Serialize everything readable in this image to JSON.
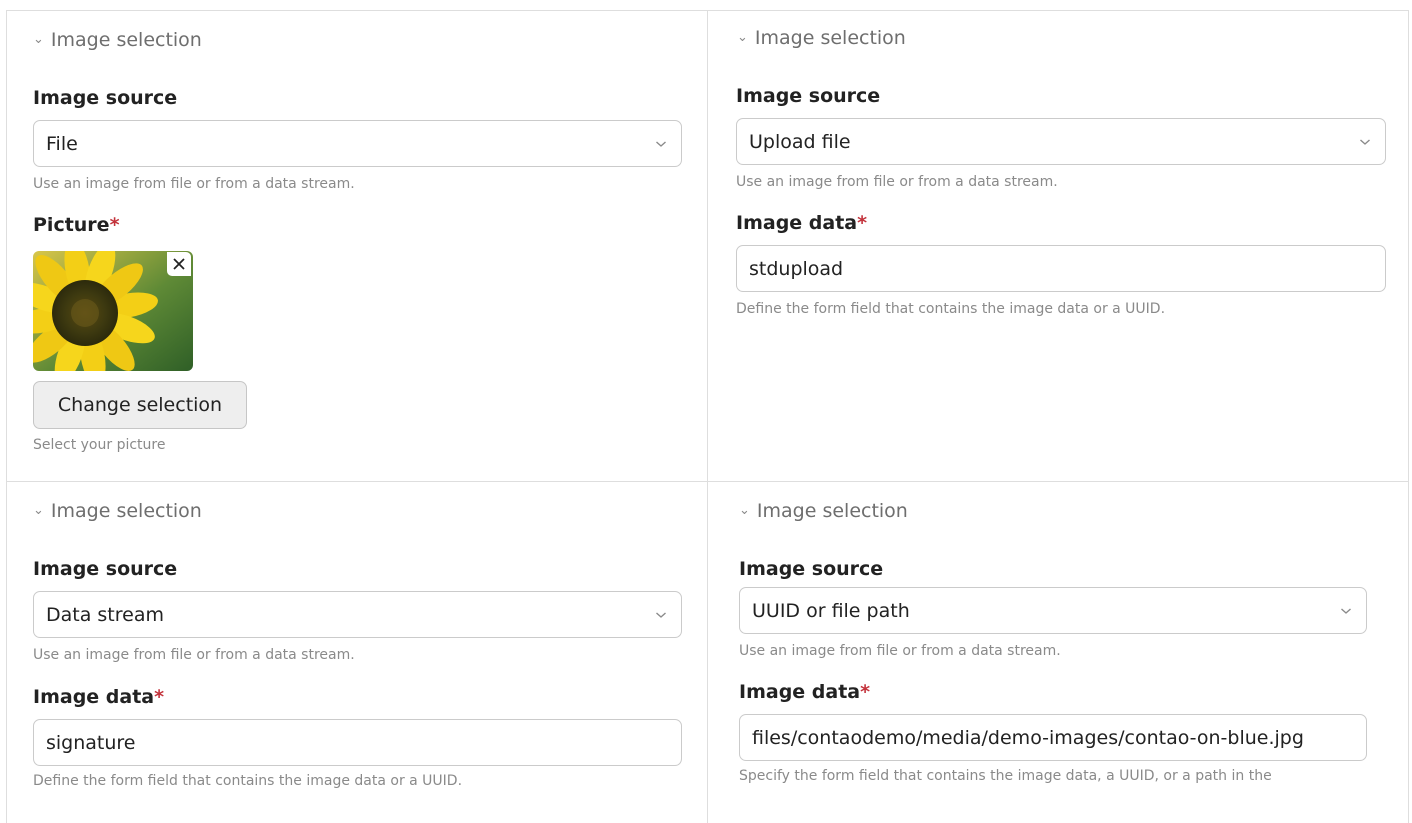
{
  "panels": [
    {
      "legend": "Image selection",
      "source_label": "Image source",
      "source_value": "File",
      "source_help": "Use an image from file or from a data stream.",
      "field_label": "Picture",
      "required_mark": "*",
      "button_label": "Change selection",
      "field_help": "Select your picture",
      "remove_icon": "close-icon"
    },
    {
      "legend": "Image selection",
      "source_label": "Image source",
      "source_value": "Upload file",
      "source_help": "Use an image from file or from a data stream.",
      "field_label": "Image data",
      "required_mark": "*",
      "field_value": "stdupload",
      "field_help": "Define the form field that contains the image data or a UUID."
    },
    {
      "legend": "Image selection",
      "source_label": "Image source",
      "source_value": "Data stream",
      "source_help": "Use an image from file or from a data stream.",
      "field_label": "Image data",
      "required_mark": "*",
      "field_value": "signature",
      "field_help": "Define the form field that contains the image data or a UUID."
    },
    {
      "legend": "Image selection",
      "source_label": "Image source",
      "source_value": "UUID or file path",
      "source_help": "Use an image from file or from a data stream.",
      "field_label": "Image data",
      "required_mark": "*",
      "field_value": "files/contaodemo/media/demo-images/contao-on-blue.jpg",
      "field_help": "Specify the form field that contains the image data, a UUID, or a path in the"
    }
  ],
  "colors": {
    "required": "#c3323b",
    "border": "#cbcbcb",
    "help_text": "#8a8a8a",
    "button_bg": "#eeeeee"
  },
  "icons": {
    "legend_toggle": "chevron-down-icon",
    "select_caret": "chevron-down-icon",
    "remove": "close-icon"
  }
}
